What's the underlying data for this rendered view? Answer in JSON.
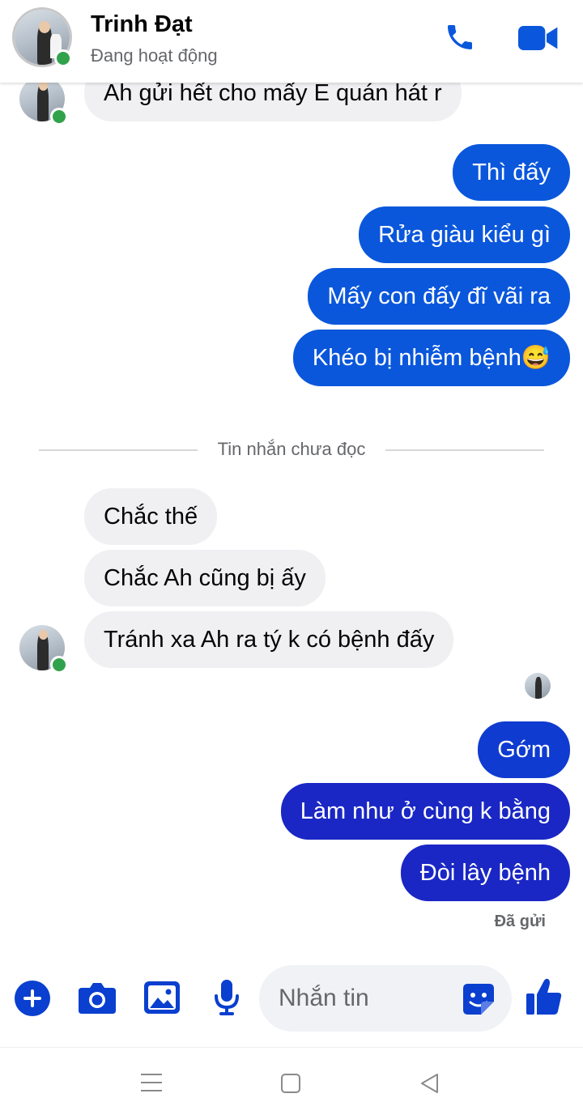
{
  "header": {
    "name": "Trinh Đạt",
    "status": "Đang hoạt động",
    "icons": [
      "phone-icon",
      "video-call-icon"
    ]
  },
  "messages": {
    "top_partial": "Ah gửi hết cho mấy E quán hát r",
    "out_group1": [
      "Thì đấy",
      "Rửa giàu kiểu gì",
      "Mấy con đấy đĩ vãi ra",
      "Khéo bị nhiễm bệnh😅"
    ],
    "unread_divider": "Tin nhắn chưa đọc",
    "in_group": [
      "Chắc thế",
      "Chắc Ah cũng bị ấy",
      "Tránh xa Ah ra tý k có bệnh đấy"
    ],
    "out_group2": [
      "Gớm",
      "Làm như ở cùng k bằng",
      "Đòi lây bệnh"
    ],
    "sent_status": "Đã gửi"
  },
  "composer": {
    "placeholder": "Nhắn tin",
    "icons": [
      "plus-icon",
      "camera-icon",
      "image-icon",
      "microphone-icon",
      "sticker-icon",
      "like-icon"
    ]
  },
  "colors": {
    "accent": "#0a3fcf",
    "incoming_bubble": "#f0f0f3",
    "online": "#31a24c"
  }
}
